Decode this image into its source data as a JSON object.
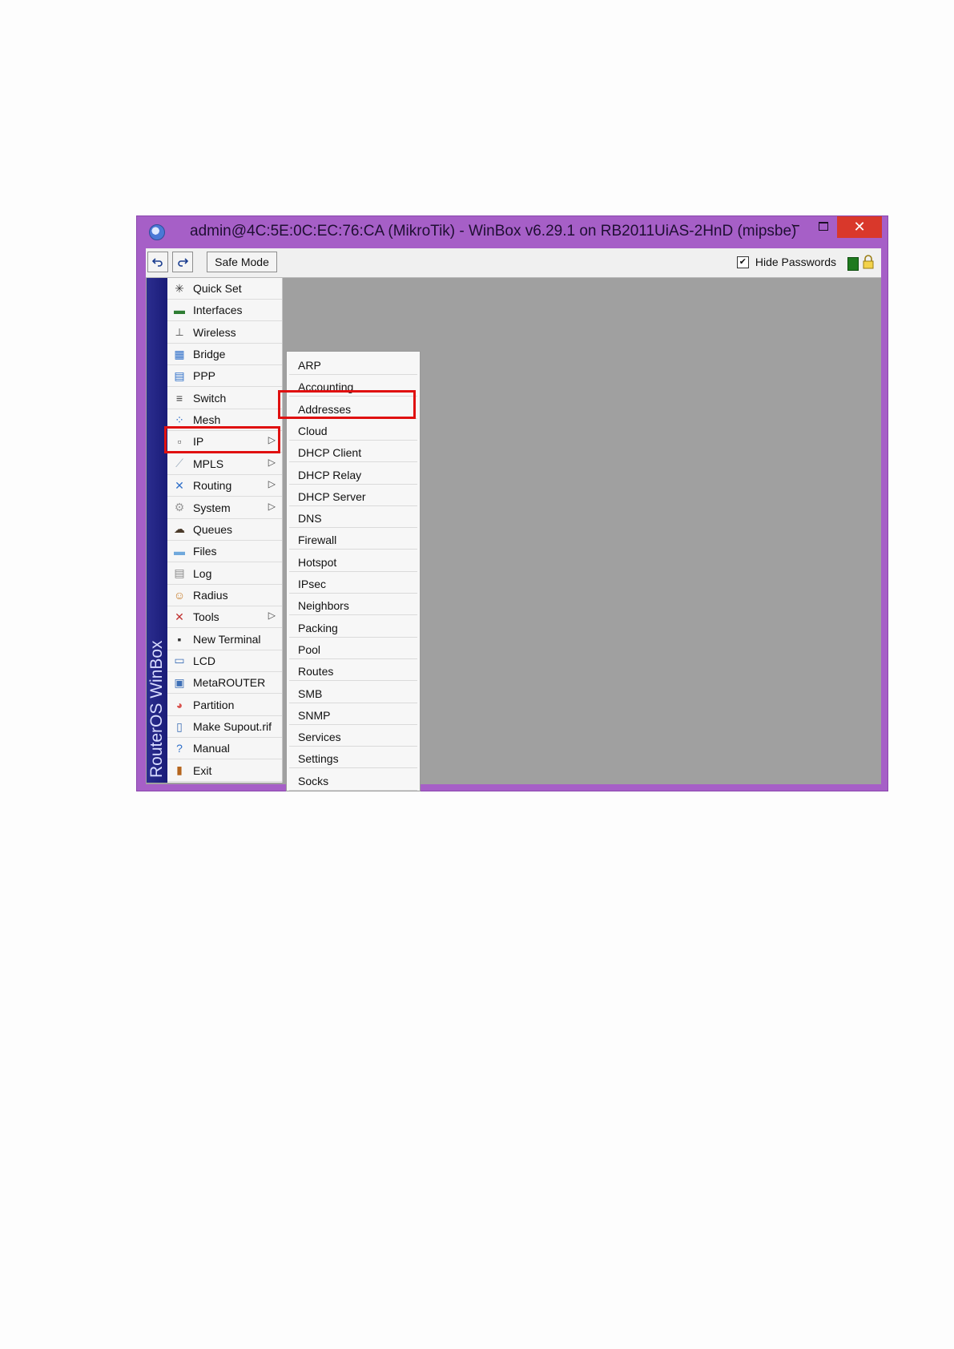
{
  "window": {
    "title": "admin@4C:5E:0C:EC:76:CA (MikroTik) - WinBox v6.29.1 on RB2011UiAS-2HnD (mipsbe)",
    "close_glyph": "✕",
    "minimize_glyph": "–"
  },
  "toolbar": {
    "undo_icon": "undo-icon",
    "redo_icon": "redo-icon",
    "safe_mode_label": "Safe Mode",
    "hide_passwords_label": "Hide Passwords",
    "hide_passwords_checked": true
  },
  "sidebar": {
    "band_label": "RouterOS WinBox",
    "items": [
      {
        "label": "Quick Set",
        "icon": "wand-icon"
      },
      {
        "label": "Interfaces",
        "icon": "interfaces-icon"
      },
      {
        "label": "Wireless",
        "icon": "antenna-icon"
      },
      {
        "label": "Bridge",
        "icon": "bridge-icon"
      },
      {
        "label": "PPP",
        "icon": "ppp-icon"
      },
      {
        "label": "Switch",
        "icon": "switch-icon"
      },
      {
        "label": "Mesh",
        "icon": "mesh-icon"
      },
      {
        "label": "IP",
        "icon": "ip-icon",
        "submenu": true
      },
      {
        "label": "MPLS",
        "icon": "mpls-icon",
        "submenu": true
      },
      {
        "label": "Routing",
        "icon": "routing-icon",
        "submenu": true
      },
      {
        "label": "System",
        "icon": "gear-icon",
        "submenu": true
      },
      {
        "label": "Queues",
        "icon": "queues-icon"
      },
      {
        "label": "Files",
        "icon": "folder-icon"
      },
      {
        "label": "Log",
        "icon": "log-icon"
      },
      {
        "label": "Radius",
        "icon": "users-icon"
      },
      {
        "label": "Tools",
        "icon": "tools-icon",
        "submenu": true
      },
      {
        "label": "New Terminal",
        "icon": "terminal-icon"
      },
      {
        "label": "LCD",
        "icon": "monitor-icon"
      },
      {
        "label": "MetaROUTER",
        "icon": "metarouter-icon"
      },
      {
        "label": "Partition",
        "icon": "pie-icon"
      },
      {
        "label": "Make Supout.rif",
        "icon": "document-icon"
      },
      {
        "label": "Manual",
        "icon": "help-icon"
      },
      {
        "label": "Exit",
        "icon": "exit-icon"
      }
    ]
  },
  "ip_submenu": {
    "items": [
      "ARP",
      "Accounting",
      "Addresses",
      "Cloud",
      "DHCP Client",
      "DHCP Relay",
      "DHCP Server",
      "DNS",
      "Firewall",
      "Hotspot",
      "IPsec",
      "Neighbors",
      "Packing",
      "Pool",
      "Routes",
      "SMB",
      "SNMP",
      "Services",
      "Settings",
      "Socks"
    ]
  },
  "colors": {
    "window_frame": "#a65fc7",
    "workspace": "#a0a0a0",
    "side_band": "#1f2185",
    "highlight": "#e01010"
  }
}
